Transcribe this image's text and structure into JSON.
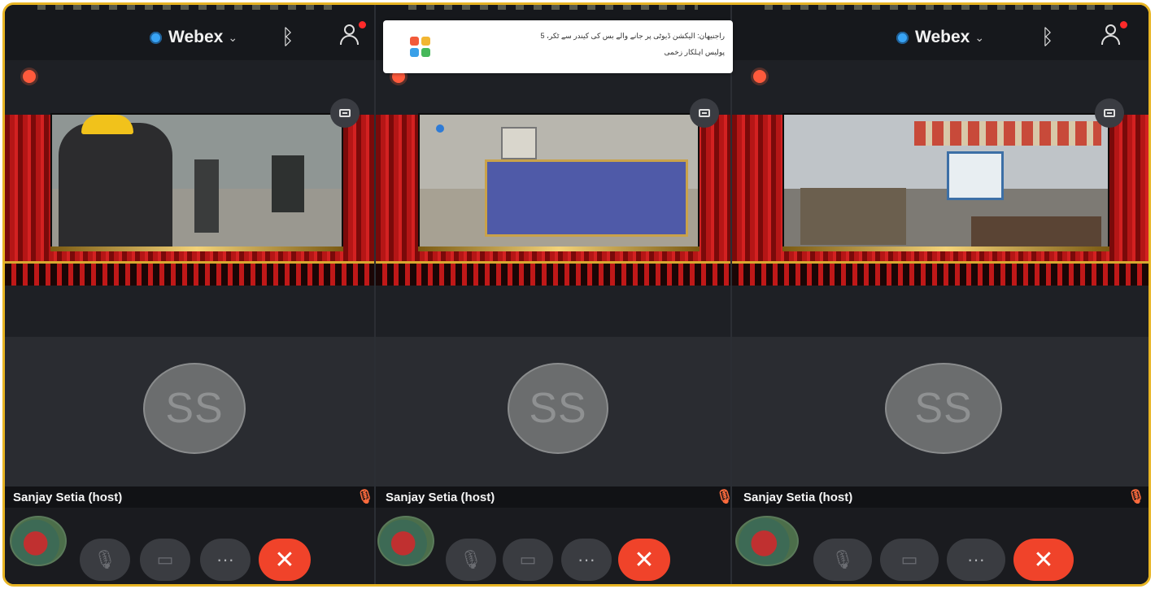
{
  "app": {
    "brand_label": "Webex",
    "brand_chevron": "⌄"
  },
  "notification": {
    "line1": "راجنیهان: الیکشن ڈیوٹی پر جانے والے بس کی کیندر سے ٹکر، 5",
    "line2": "پولیس اہلکار زخمی"
  },
  "panels": [
    {
      "id": "1",
      "participant": {
        "initials": "SS",
        "name": "Sanjay Setia (host)"
      }
    },
    {
      "id": "2",
      "participant": {
        "initials": "SS",
        "name": "Sanjay Setia (host)"
      }
    },
    {
      "id": "3",
      "participant": {
        "initials": "SS",
        "name": "Sanjay Setia (host)"
      }
    }
  ],
  "controls": {
    "more_label": "···",
    "end_label": "✕",
    "mute_label": "🎙",
    "video_label": "▭"
  },
  "icons": {
    "bluetooth": "ᛒ",
    "muted_mic": "🎙",
    "colors": {
      "accent_red": "#f0432a",
      "webex_blue": "#38a3f4",
      "frame_gold": "#e8b524"
    }
  }
}
